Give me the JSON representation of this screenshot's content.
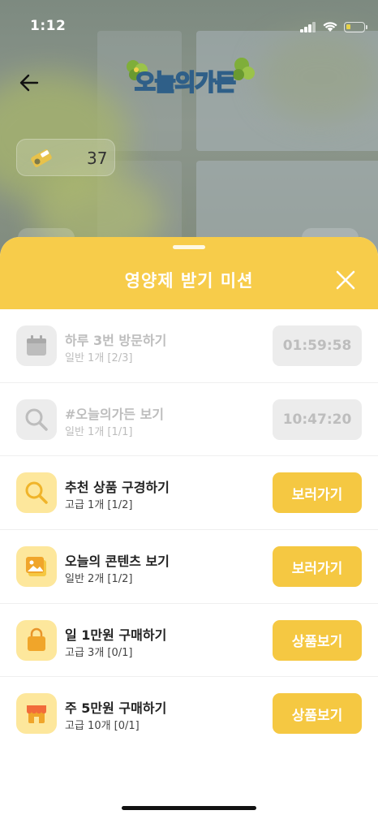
{
  "status_bar": {
    "time": "1:12"
  },
  "header": {
    "logo_text": "오늘의가든"
  },
  "counter": {
    "value": "37"
  },
  "sheet": {
    "title": "영양제 받기 미션",
    "missions": [
      {
        "title": "하루 3번 방문하기",
        "subtitle": "일반 1개 [2/3]",
        "button": "01:59:58",
        "state": "done",
        "icon": "calendar-icon"
      },
      {
        "title": "#오늘의가든 보기",
        "subtitle": "일반 1개 [1/1]",
        "button": "10:47:20",
        "state": "done",
        "icon": "search-icon"
      },
      {
        "title": "추천 상품 구경하기",
        "subtitle": "고급 1개 [1/2]",
        "button": "보러가기",
        "state": "active",
        "icon": "search-icon"
      },
      {
        "title": "오늘의 콘텐츠 보기",
        "subtitle": "일반 2개 [1/2]",
        "button": "보러가기",
        "state": "active",
        "icon": "image-icon"
      },
      {
        "title": "일 1만원 구매하기",
        "subtitle": "고급 3개 [0/1]",
        "button": "상품보기",
        "state": "active",
        "icon": "shopping-bag-icon"
      },
      {
        "title": "주 5만원 구매하기",
        "subtitle": "고급 10개 [0/1]",
        "button": "상품보기",
        "state": "active",
        "icon": "store-icon"
      }
    ]
  },
  "colors": {
    "accent": "#f7cc4a",
    "button_active": "#f5c842",
    "icon_bg_active": "#fde79c",
    "disabled": "#ececec",
    "disabled_text": "#bdbdbd"
  }
}
